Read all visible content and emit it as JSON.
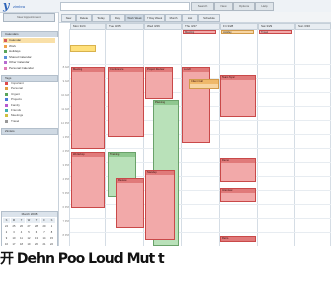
{
  "header": {
    "logo_word": "zimbra",
    "search_placeholder": "",
    "search_btn": "Search",
    "new_btn": "New",
    "options_btn": "Options",
    "help_btn": "Help",
    "user_link": ""
  },
  "sidebar": {
    "new_appt": "New Appointment",
    "calendars_header": "Calendars",
    "calendars": [
      {
        "label": "Calendar",
        "color": "#d85b5b"
      },
      {
        "label": "Work",
        "color": "#f0a24a"
      },
      {
        "label": "Holidays",
        "color": "#5aa55a"
      },
      {
        "label": "Shared Calendar",
        "color": "#5a8fd8"
      },
      {
        "label": "Other Calendar",
        "color": "#b66bd0"
      },
      {
        "label": "Personal Calendar",
        "color": "#e07fb8"
      }
    ],
    "tags_header": "Tags",
    "tags": [
      {
        "label": "Important",
        "color": "#e04a4a"
      },
      {
        "label": "Personal",
        "color": "#e0a040"
      },
      {
        "label": "Urgent",
        "color": "#5aa55a"
      },
      {
        "label": "Projects",
        "color": "#4a7ad8"
      },
      {
        "label": "Family",
        "color": "#b65ad0"
      },
      {
        "label": "Friends",
        "color": "#40b0b0"
      },
      {
        "label": "Meetings",
        "color": "#d0c040"
      },
      {
        "label": "Travel",
        "color": "#999999"
      }
    ],
    "zimlets_header": "Zimlets",
    "mini_cal": {
      "title": "March 2008",
      "weekdays": [
        "S",
        "M",
        "T",
        "W",
        "T",
        "F",
        "S"
      ],
      "days": [
        "24",
        "25",
        "26",
        "27",
        "28",
        "29",
        "1",
        "2",
        "3",
        "4",
        "5",
        "6",
        "7",
        "8",
        "9",
        "10",
        "11",
        "12",
        "13",
        "14",
        "15",
        "16",
        "17",
        "18",
        "19",
        "20",
        "21",
        "22",
        "23",
        "24",
        "25",
        "26",
        "27",
        "28",
        "29",
        "30",
        "31",
        "1",
        "2",
        "3",
        "4",
        "5"
      ]
    }
  },
  "toolbar": {
    "buttons": [
      "New",
      "Delete",
      "Today",
      "Day",
      "Work Week",
      "7 Day Week",
      "Month",
      "List",
      "Schedule"
    ]
  },
  "calendar": {
    "days": [
      "Mon 3/24",
      "Tue 3/25",
      "Wed 3/26",
      "Thu 3/27",
      "Fri 3/28",
      "Sat 3/29",
      "Sun 3/30"
    ],
    "hours": [
      "8 AM",
      "9 AM",
      "10 AM",
      "11 AM",
      "12 PM",
      "1 PM",
      "2 PM",
      "3 PM",
      "4 PM",
      "5 PM",
      "6 PM",
      "7 PM",
      "8 PM"
    ],
    "allday": [
      "Meeting",
      "Holiday",
      "Travel"
    ],
    "appts": [
      "Meeting",
      "Conference",
      "Project Review",
      "Lunch",
      "Team Sync",
      "Planning",
      "Client Call",
      "Workshop",
      "Training",
      "Review",
      "Standup",
      "Demo",
      "Interview",
      "Retro"
    ]
  },
  "banner": {
    "text": "开 Dehn Poo Loud Mut t"
  }
}
